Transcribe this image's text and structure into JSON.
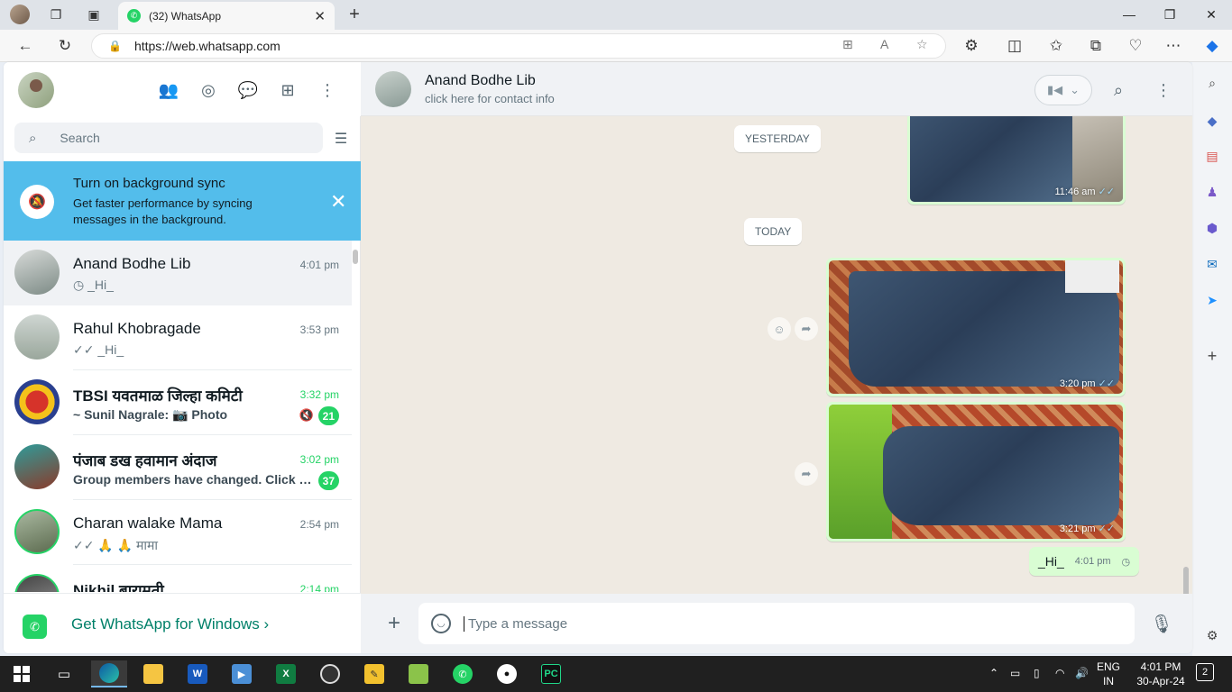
{
  "browser": {
    "tab_title": "(32) WhatsApp",
    "url": "https://web.whatsapp.com"
  },
  "left_pane": {
    "search_placeholder": "Search",
    "banner": {
      "title": "Turn on background sync",
      "subtitle": "Get faster performance by syncing messages in the background."
    },
    "chats": [
      {
        "name": "Anand Bodhe Lib",
        "time": "4:01 pm",
        "preview": "_Hi_",
        "preview_icon": "◷",
        "active": true
      },
      {
        "name": "Rahul Khobragade",
        "time": "3:53 pm",
        "preview": "_Hi_",
        "preview_icon": "✓✓"
      },
      {
        "name": "TBSI यवतमाळ जिल्हा कमिटी",
        "time": "3:32 pm",
        "preview": "~ Sunil Nagrale: 📷 Photo",
        "unread": "21",
        "muted": true
      },
      {
        "name": "पंजाब डख हवामान अंदाज",
        "time": "3:02 pm",
        "preview": "Group members have changed. Click to...",
        "unread": "37"
      },
      {
        "name": "Charan walake Mama",
        "time": "2:54 pm",
        "preview": "🙏 🙏 मामा",
        "preview_icon": "✓✓"
      },
      {
        "name": "Nikhil बारामती",
        "time": "2:14 pm",
        "preview": ""
      }
    ],
    "footer_link": "Get WhatsApp for Windows"
  },
  "conversation": {
    "contact_name": "Anand Bodhe Lib",
    "contact_sub": "click here for contact info",
    "date_yesterday": "YESTERDAY",
    "date_today": "TODAY",
    "msg_yesterday_time": "11:46 am",
    "msg_img1_time": "3:20 pm",
    "msg_img2_time": "3:21 pm",
    "msg_text": "_Hi_",
    "msg_text_time": "4:01 pm",
    "composer_placeholder": "Type a message"
  },
  "taskbar": {
    "lang1": "ENG",
    "lang2": "IN",
    "time": "4:01 PM",
    "date": "30-Apr-24",
    "notifications": "2"
  },
  "colors": {
    "whatsapp_green": "#25d366",
    "banner_blue": "#53bdeb",
    "outgoing_bubble": "#d9fdd3",
    "chat_background": "#efeae2"
  }
}
